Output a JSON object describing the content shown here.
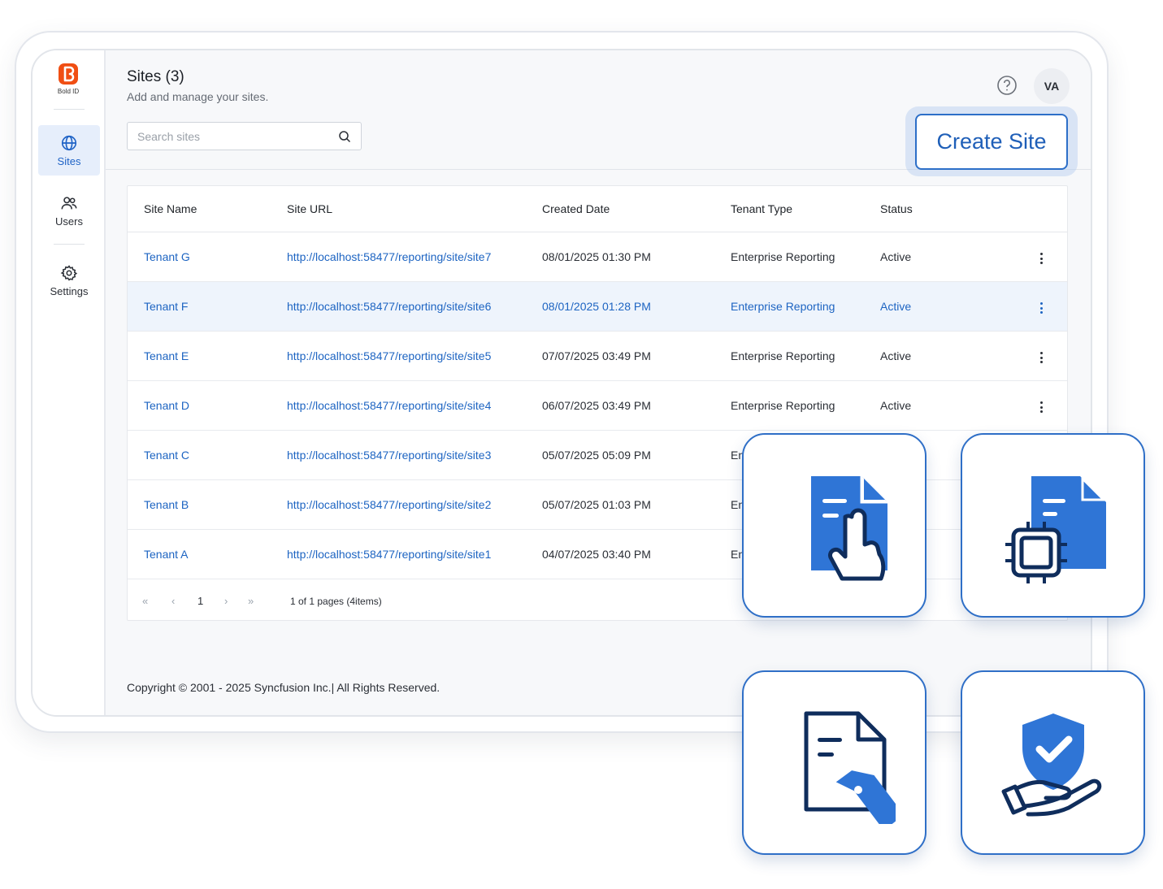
{
  "brand": {
    "name": "Bold ID",
    "accent": "#1f63c6",
    "logo_color": "#f04e13"
  },
  "sidebar": {
    "items": [
      {
        "label": "Sites",
        "icon": "globe-icon",
        "active": true
      },
      {
        "label": "Users",
        "icon": "users-icon",
        "active": false
      },
      {
        "label": "Settings",
        "icon": "gear-icon",
        "active": false
      }
    ]
  },
  "header": {
    "title": "Sites (3)",
    "subtitle": "Add and manage your sites.",
    "avatar_initials": "VA",
    "help_icon": "help-circle-icon"
  },
  "search": {
    "placeholder": "Search sites",
    "value": ""
  },
  "create_button": {
    "label": "Create Site"
  },
  "table": {
    "columns": [
      "Site Name",
      "Site URL",
      "Created Date",
      "Tenant Type",
      "Status"
    ],
    "rows": [
      {
        "name": "Tenant G",
        "url": "http://localhost:58477/reporting/site/site7",
        "created": "08/01/2025 01:30 PM",
        "type": "Enterprise Reporting",
        "status": "Active"
      },
      {
        "name": "Tenant F",
        "url": "http://localhost:58477/reporting/site/site6",
        "created": "08/01/2025 01:28 PM",
        "type": "Enterprise Reporting",
        "status": "Active"
      },
      {
        "name": "Tenant E",
        "url": "http://localhost:58477/reporting/site/site5",
        "created": "07/07/2025 03:49 PM",
        "type": "Enterprise Reporting",
        "status": "Active"
      },
      {
        "name": "Tenant D",
        "url": "http://localhost:58477/reporting/site/site4",
        "created": "06/07/2025 03:49 PM",
        "type": "Enterprise Reporting",
        "status": "Active"
      },
      {
        "name": "Tenant C",
        "url": "http://localhost:58477/reporting/site/site3",
        "created": "05/07/2025 05:09 PM",
        "type": "En",
        "status": ""
      },
      {
        "name": "Tenant B",
        "url": "http://localhost:58477/reporting/site/site2",
        "created": "05/07/2025 01:03 PM",
        "type": "En",
        "status": ""
      },
      {
        "name": "Tenant A",
        "url": "http://localhost:58477/reporting/site/site1",
        "created": "04/07/2025 03:40 PM",
        "type": "En",
        "status": ""
      }
    ]
  },
  "pager": {
    "first": "«",
    "prev": "‹",
    "page": "1",
    "next": "›",
    "last": "»",
    "info": "1 of 1 pages (4items)"
  },
  "footer": {
    "copyright": "Copyright © 2001 - 2025 Syncfusion Inc.| All Rights Reserved."
  },
  "tiles": [
    {
      "icon": "document-touch-icon"
    },
    {
      "icon": "document-chip-icon"
    },
    {
      "icon": "document-tag-icon"
    },
    {
      "icon": "shield-hand-icon"
    }
  ]
}
